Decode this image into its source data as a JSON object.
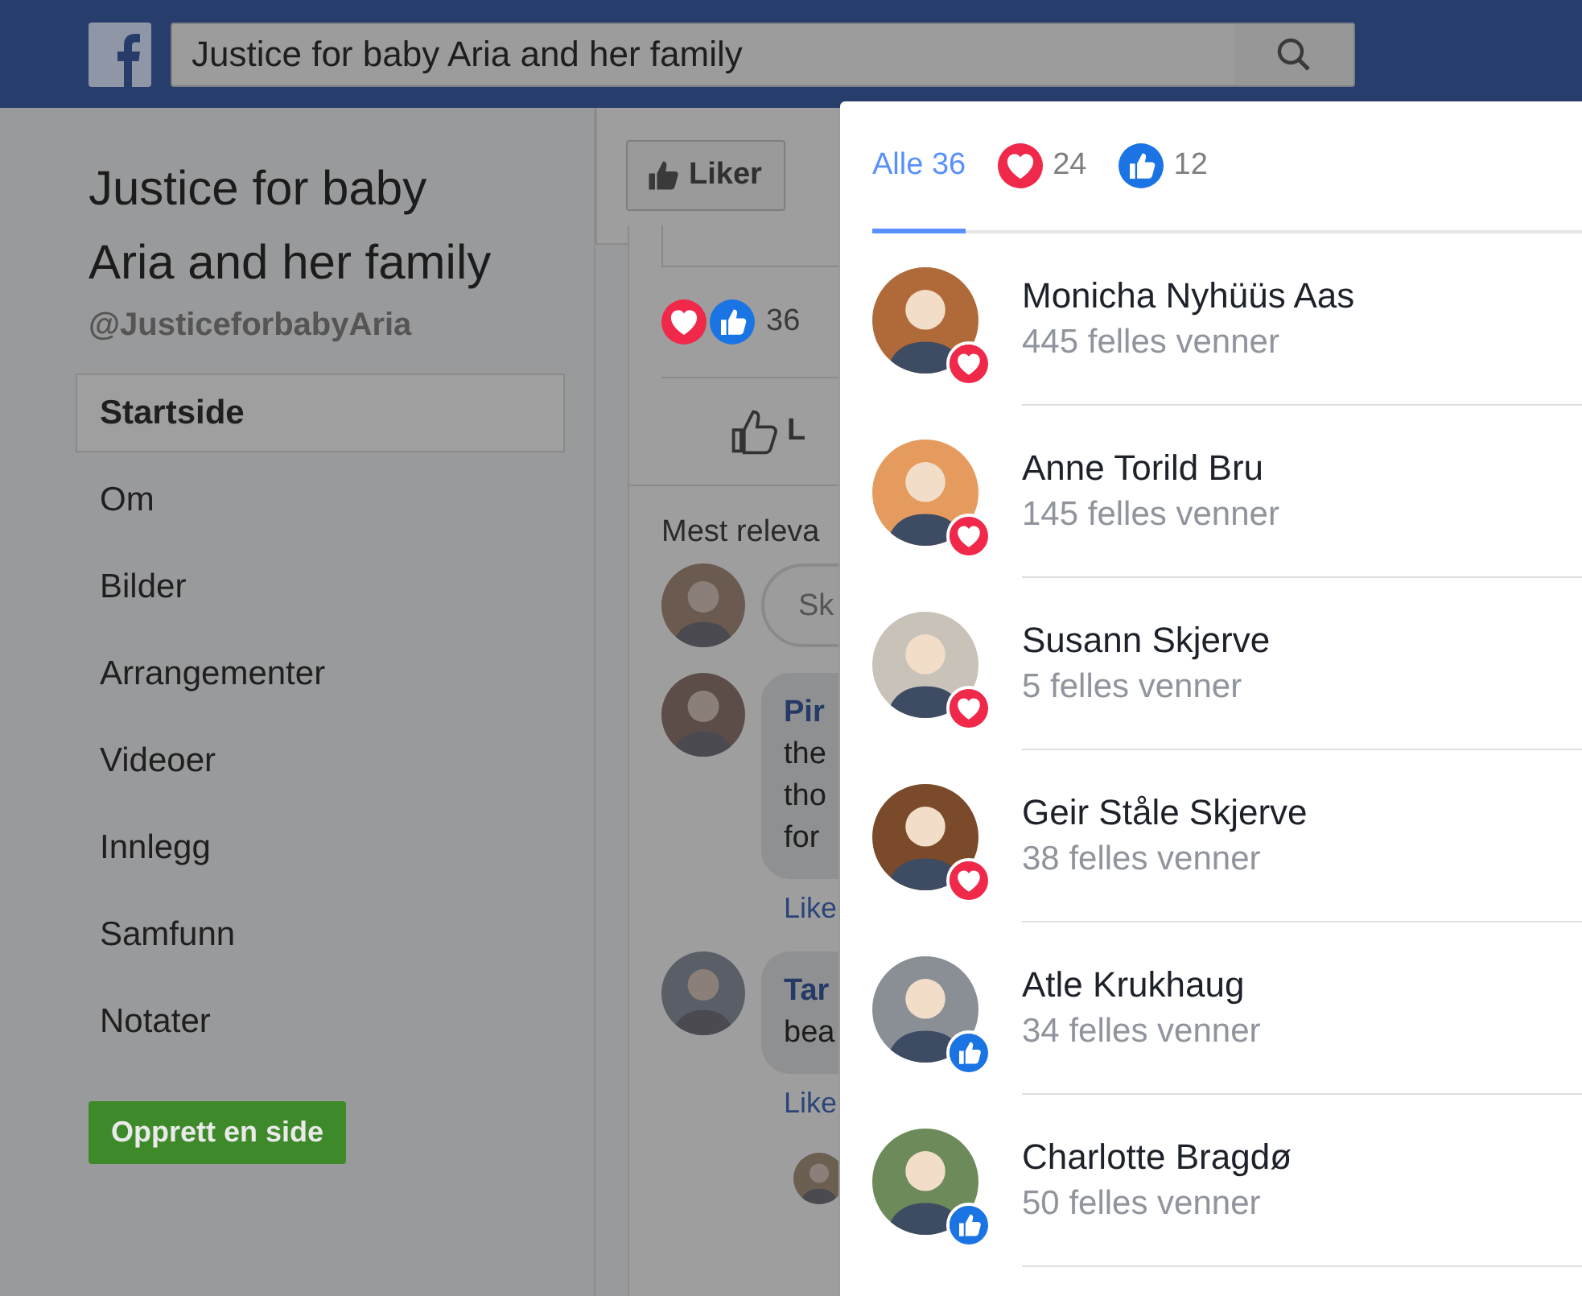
{
  "header": {
    "search_value": "Justice for baby Aria and her family"
  },
  "page": {
    "name": "Justice for baby Aria and her family",
    "handle": "@JusticeforbabyAria"
  },
  "sidebar": {
    "items": [
      {
        "label": "Startside",
        "selected": true
      },
      {
        "label": "Om",
        "selected": false
      },
      {
        "label": "Bilder",
        "selected": false
      },
      {
        "label": "Arrangementer",
        "selected": false
      },
      {
        "label": "Videoer",
        "selected": false
      },
      {
        "label": "Innlegg",
        "selected": false
      },
      {
        "label": "Samfunn",
        "selected": false
      },
      {
        "label": "Notater",
        "selected": false
      }
    ],
    "create_button": "Opprett en side"
  },
  "feed": {
    "like_button": "Liker",
    "reaction_count": "36",
    "like_action": "L",
    "sort_label": "Mest releva",
    "comment_placeholder": "Sk",
    "comments": [
      {
        "author": "Pir",
        "lines": [
          "the",
          "tho",
          "for"
        ],
        "action": "Like"
      },
      {
        "author": "Tar",
        "lines": [
          "bea"
        ],
        "action": "Like"
      }
    ]
  },
  "dialog": {
    "tabs": [
      {
        "kind": "all",
        "label": "Alle 36",
        "selected": true
      },
      {
        "kind": "love",
        "label": "24",
        "selected": false
      },
      {
        "kind": "like",
        "label": "12",
        "selected": false
      }
    ],
    "people": [
      {
        "name": "Monicha Nyhüüs Aas",
        "mutual": "445 felles venner",
        "kind": "love"
      },
      {
        "name": "Anne Torild Bru",
        "mutual": "145 felles venner",
        "kind": "love"
      },
      {
        "name": "Susann Skjerve",
        "mutual": "5 felles venner",
        "kind": "love"
      },
      {
        "name": "Geir Ståle Skjerve",
        "mutual": "38 felles venner",
        "kind": "love"
      },
      {
        "name": "Atle Krukhaug",
        "mutual": "34 felles venner",
        "kind": "like"
      },
      {
        "name": "Charlotte Bragdø",
        "mutual": "50 felles venner",
        "kind": "like"
      }
    ]
  }
}
